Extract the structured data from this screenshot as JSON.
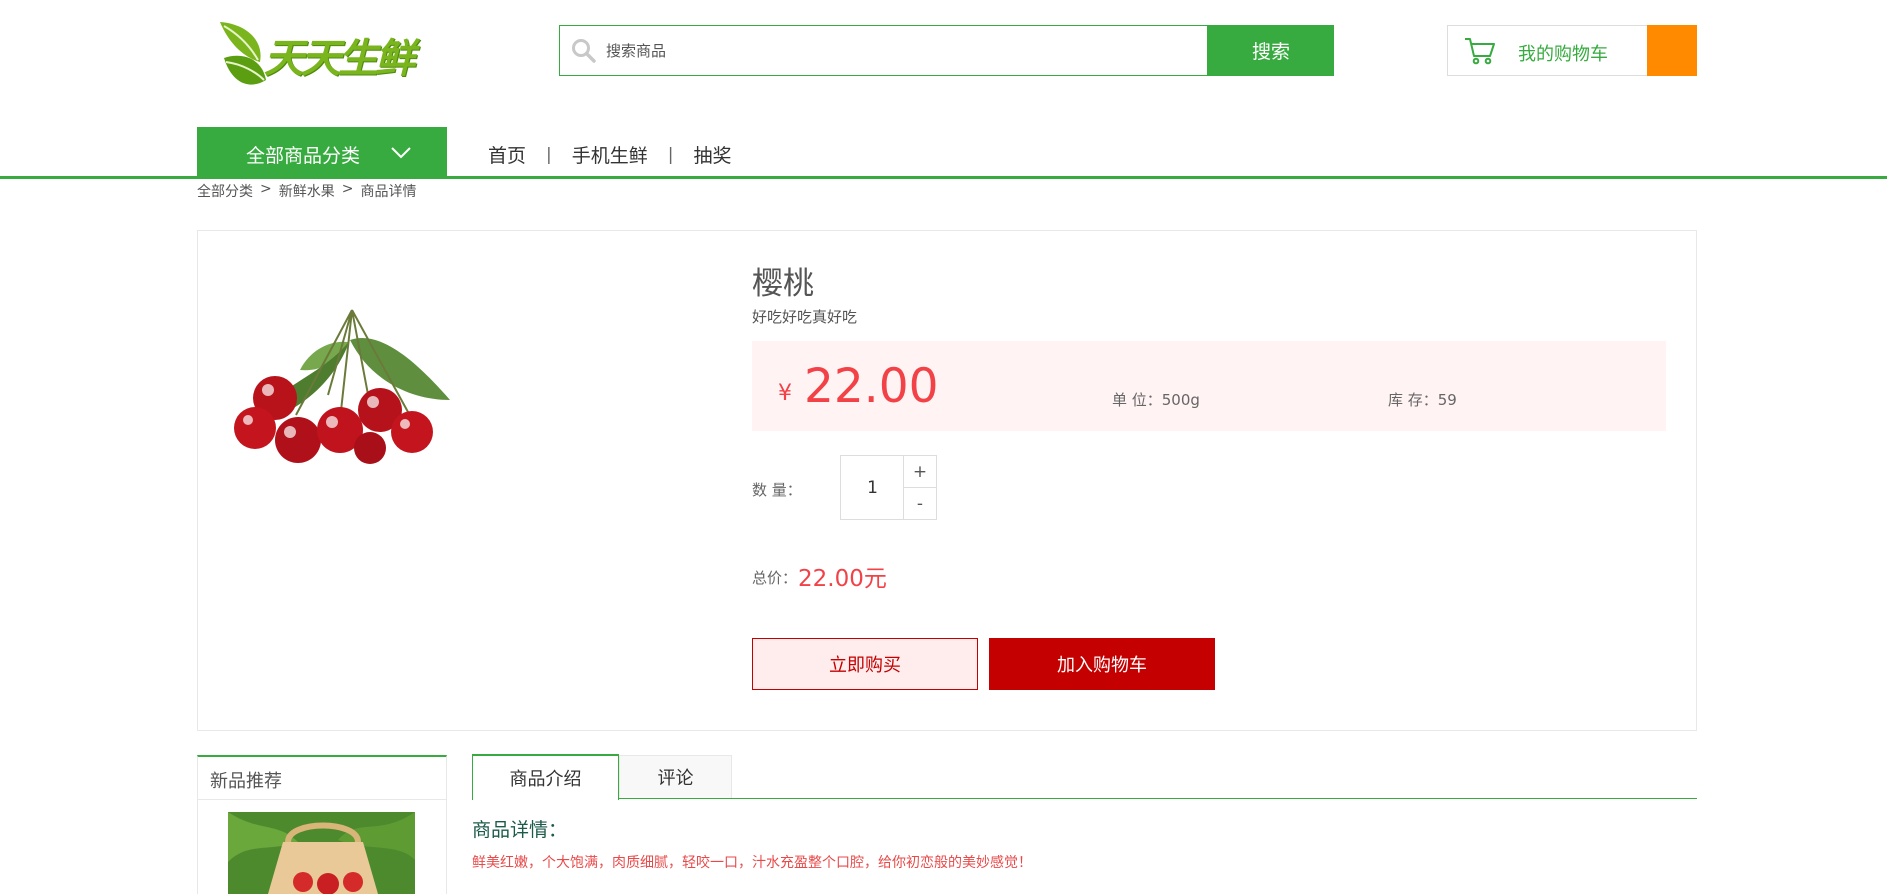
{
  "header": {
    "logo_text": "天天生鲜",
    "search": {
      "placeholder": "搜索商品",
      "button_label": "搜索"
    },
    "cart": {
      "label": "我的购物车",
      "count": ""
    }
  },
  "nav": {
    "category_label": "全部商品分类",
    "links": [
      "首页",
      "手机生鲜",
      "抽奖"
    ],
    "separator": "|"
  },
  "breadcrumb": {
    "items": [
      "全部分类",
      "新鲜水果",
      "商品详情"
    ],
    "separator": ">"
  },
  "product": {
    "name": "樱桃",
    "subtitle": "好吃好吃真好吃",
    "currency": "¥",
    "price": "22.00",
    "unit_text": "单 位：500g",
    "stock_text": "库 存：59",
    "quantity_label": "数 量：",
    "quantity": "1",
    "plus": "+",
    "minus": "-",
    "total_label": "总价：",
    "total_value": "22.00元",
    "buy_now_label": "立即购买",
    "add_cart_label": "加入购物车"
  },
  "sidebar": {
    "title": "新品推荐"
  },
  "tabs": [
    {
      "label": "商品介绍",
      "active": true
    },
    {
      "label": "评论",
      "active": false
    }
  ],
  "detail": {
    "title": "商品详情：",
    "text": "鲜美红嫩，个大饱满，肉质细腻，轻咬一口，汁水充盈整个口腔，给你初恋般的美妙感觉！"
  },
  "colors": {
    "brand_green": "#37ab40",
    "price_red": "#f24247",
    "button_red": "#c40000",
    "cart_orange": "#ff8a00"
  },
  "icons": {
    "search": "search-icon",
    "cart": "cart-icon",
    "chevron": "chevron-down-icon",
    "logo": "leaf-logo-icon"
  }
}
